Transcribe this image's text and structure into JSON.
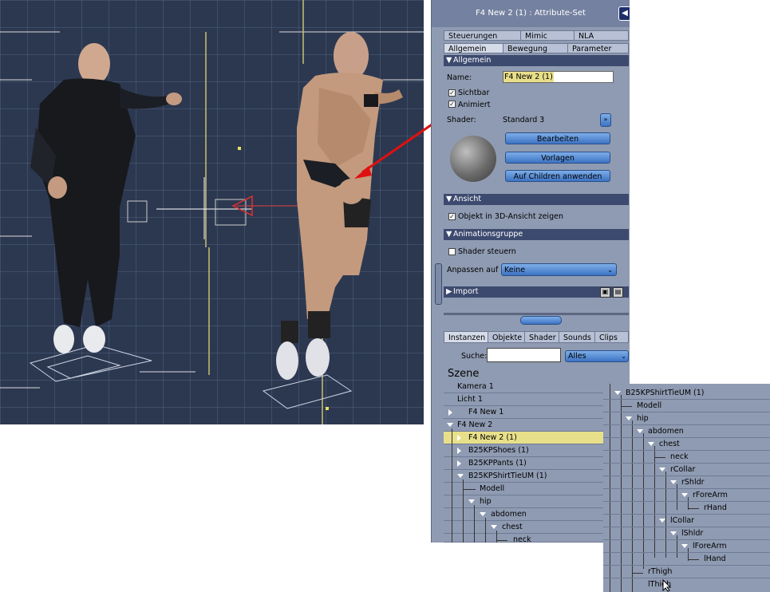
{
  "panel": {
    "title": "F4 New 2 (1) : Attribute-Set",
    "tabs_row1": [
      "Steuerungen",
      "Mimic",
      "NLA"
    ],
    "tabs_row2": [
      "Allgemein",
      "Bewegung",
      "Parameter"
    ],
    "general": {
      "section": "Allgemein",
      "name_label": "Name:",
      "name_value": "F4 New 2 (1)",
      "visible_label": "Sichtbar",
      "animated_label": "Animiert",
      "shader_label": "Shader:",
      "shader_value": "Standard 3",
      "edit_button": "Bearbeiten",
      "presets_button": "Vorlagen",
      "apply_children_button": "Auf Children anwenden"
    },
    "view": {
      "section": "Ansicht",
      "show_in_3d_label": "Objekt in 3D-Ansicht zeigen"
    },
    "animgroup": {
      "section": "Animationsgruppe",
      "shader_control_label": "Shader steuern",
      "fit_label": "Anpassen auf",
      "fit_value": "Keine"
    },
    "import": {
      "section": "Import"
    }
  },
  "scene": {
    "tabs": [
      "Instanzen",
      "Objekte",
      "Shader",
      "Sounds",
      "Clips"
    ],
    "search_label": "Suche:",
    "search_value": "",
    "filter_value": "Alles",
    "header": "Szene",
    "items": [
      {
        "label": "Kamera 1"
      },
      {
        "label": "Licht 1"
      },
      {
        "label": "F4 New 1"
      },
      {
        "label": "F4 New 2"
      },
      {
        "label": "F4 New 2 (1)"
      },
      {
        "label": "B25KPShoes (1)"
      },
      {
        "label": "B25KPPants (1)"
      },
      {
        "label": "B25KPShirtTieUM (1)"
      },
      {
        "label": "Modell"
      },
      {
        "label": "hip"
      },
      {
        "label": "abdomen"
      },
      {
        "label": "chest"
      },
      {
        "label": "neck"
      }
    ]
  },
  "inset": {
    "items": [
      {
        "label": "B25KPShirtTieUM (1)"
      },
      {
        "label": "Modell"
      },
      {
        "label": "hip"
      },
      {
        "label": "abdomen"
      },
      {
        "label": "chest"
      },
      {
        "label": "neck"
      },
      {
        "label": "rCollar"
      },
      {
        "label": "rShldr"
      },
      {
        "label": "rForeArm"
      },
      {
        "label": "rHand"
      },
      {
        "label": "lCollar"
      },
      {
        "label": "lShldr"
      },
      {
        "label": "lForeArm"
      },
      {
        "label": "lHand"
      },
      {
        "label": "rThigh"
      },
      {
        "label": "lThigh"
      }
    ]
  },
  "colors": {
    "highlight": "#e8df8a",
    "arrow": "#e01010",
    "panel": "#8f9bb2",
    "section": "#3d4a6f"
  }
}
